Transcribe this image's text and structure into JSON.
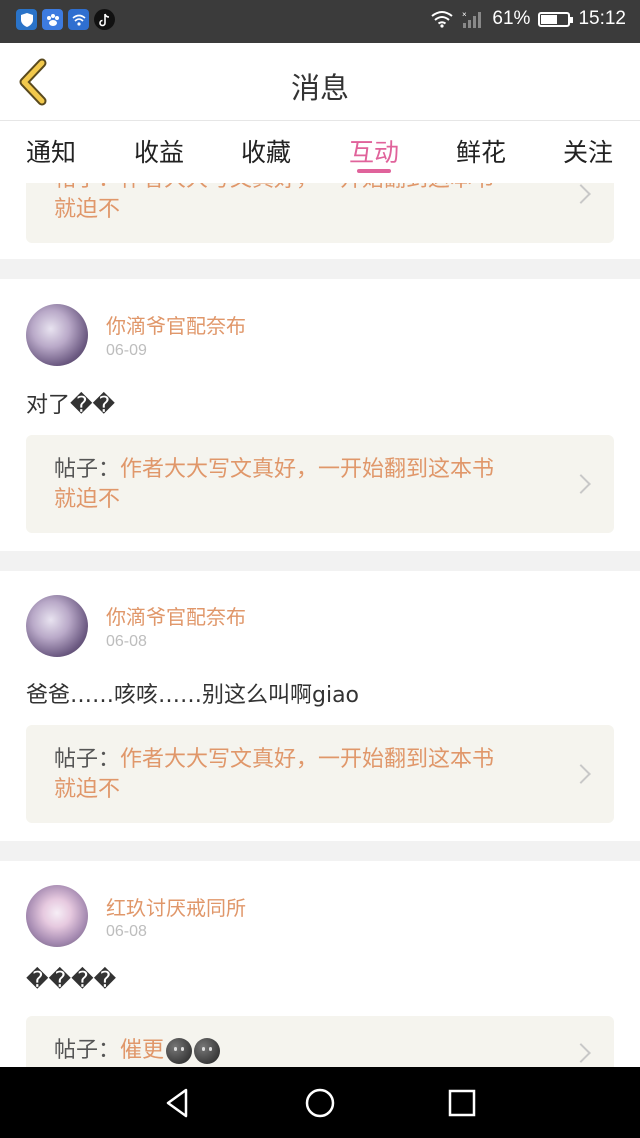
{
  "status_bar": {
    "icons": [
      "shield-app-icon",
      "paw-app-icon",
      "wifi-app-icon",
      "tiktok-app-icon"
    ],
    "signal_icons": [
      "wifi-icon",
      "signal-icon"
    ],
    "battery_text": "61%",
    "battery_level": 0.61,
    "time": "15:12"
  },
  "header": {
    "title": "消息"
  },
  "tabs": [
    "通知",
    "收益",
    "收藏",
    "互动",
    "鲜花",
    "关注"
  ],
  "active_tab": "互动",
  "post_label": "帖子：",
  "partial_card": {
    "post_line1": "帖子：作者大大写文真好，一开始翻到这本书",
    "post_line2": "就迫不"
  },
  "messages": [
    {
      "username": "你滴爷官配奈布",
      "date": "06-09",
      "text": "对了��",
      "post_title_line1": "作者大大写文真好，一开始翻到这本书",
      "post_title_line2": "就迫不"
    },
    {
      "username": "你滴爷官配奈布",
      "date": "06-08",
      "text": "爸爸……咳咳……别这么叫啊giao",
      "post_title_line1": "作者大大写文真好，一开始翻到这本书",
      "post_title_line2": "就迫不"
    },
    {
      "username": "红玖讨厌戒同所",
      "date": "06-08",
      "text": "����",
      "post_title_line1": "催更",
      "post_title_line2": ""
    }
  ],
  "colors": {
    "accent_pink": "#e0639b",
    "name_orange": "#e0976a",
    "post_bg": "#f5f4ee"
  }
}
